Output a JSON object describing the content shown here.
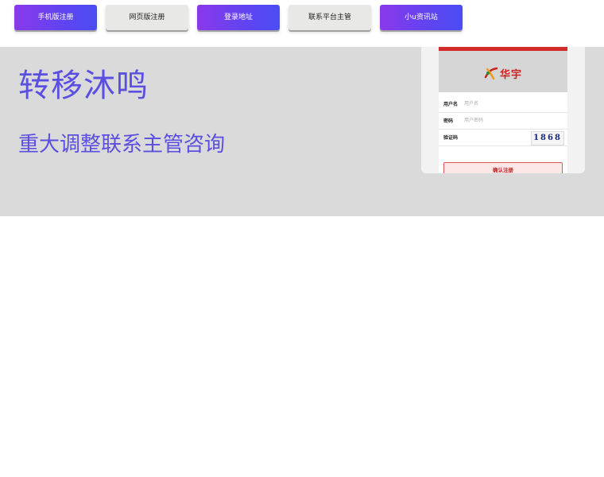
{
  "nav": {
    "buttons": [
      {
        "label": "手机版注册",
        "style": "purple"
      },
      {
        "label": "网页版注册",
        "style": "grey"
      },
      {
        "label": "登录地址",
        "style": "purple"
      },
      {
        "label": "联系平台主管",
        "style": "grey"
      },
      {
        "label": "小u资讯站",
        "style": "purple"
      }
    ]
  },
  "hero": {
    "title": "转移沐鸣",
    "subtitle": "重大调整联系主管咨询"
  },
  "phone": {
    "brand": "华宇",
    "username_label": "用户名",
    "username_placeholder": "用户名",
    "password_label": "密码",
    "password_placeholder": "用户密码",
    "captcha_label": "验证码",
    "captcha_code": "1868",
    "confirm_label": "确认注册"
  },
  "colors": {
    "accent_purple": "#5f44f0",
    "hero_text": "#5a4fe0",
    "hero_bg": "#dadada",
    "brand_red": "#c8231e"
  }
}
